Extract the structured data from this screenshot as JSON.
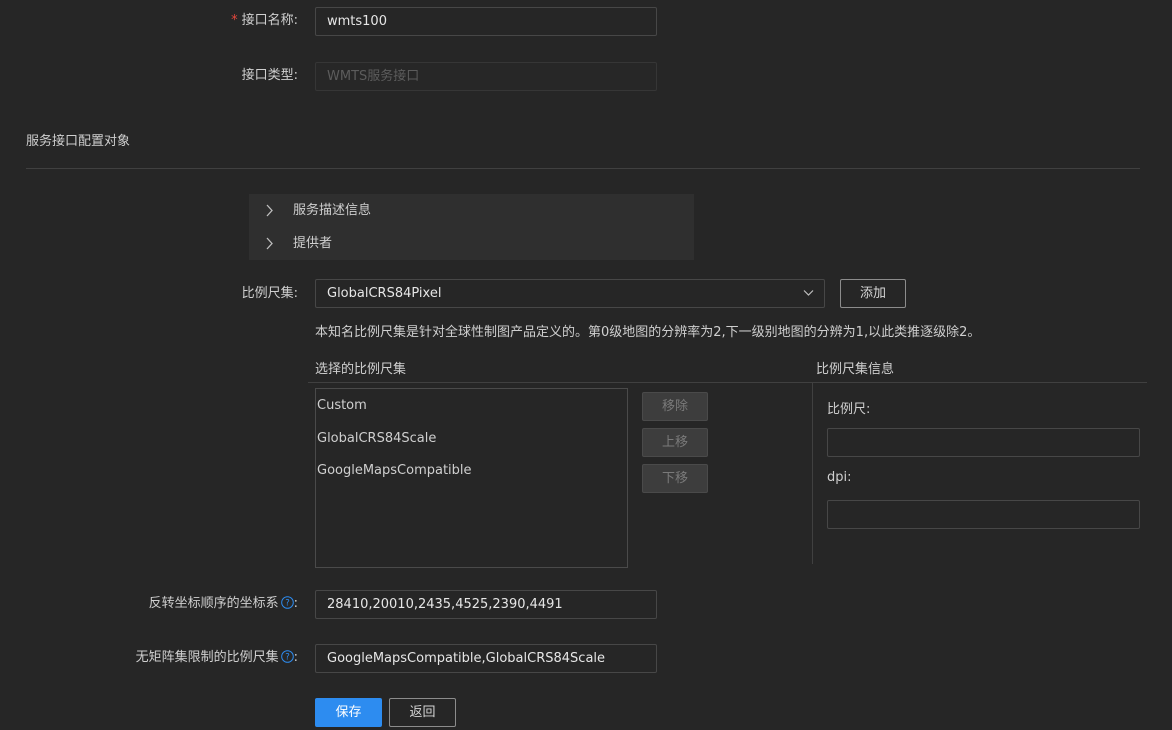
{
  "form": {
    "name_label": "接口名称:",
    "name_value": "wmts100",
    "type_label": "接口类型:",
    "type_placeholder": "WMTS服务接口",
    "section_title": "服务接口配置对象",
    "collapse": [
      "服务描述信息",
      "提供者"
    ],
    "scale_label": "比例尺集:",
    "scale_selected": "GlobalCRS84Pixel",
    "add_button": "添加",
    "scale_hint": "本知名比例尺集是针对全球性制图产品定义的。第0级地图的分辨率为2,下一级别地图的分辨为1,以此类推逐级除2。",
    "selected_title": "选择的比例尺集",
    "info_title": "比例尺集信息",
    "selected_items": [
      "Custom",
      "GlobalCRS84Scale",
      "GoogleMapsCompatible"
    ],
    "remove_button": "移除",
    "up_button": "上移",
    "down_button": "下移",
    "scale_field_label": "比例尺:",
    "dpi_field_label": "dpi:",
    "reverse_label": "反转坐标顺序的坐标系",
    "reverse_value": "28410,20010,2435,4525,2390,4491",
    "unlimited_label": "无矩阵集限制的比例尺集",
    "unlimited_value": "GoogleMapsCompatible,GlobalCRS84Scale",
    "colon": ":",
    "save_button": "保存",
    "back_button": "返回"
  },
  "icons": {
    "chevron": "chevron-right-icon",
    "dropdown": "chevron-down-icon",
    "help": "question-circle-icon"
  },
  "colors": {
    "background": "#262626",
    "primary": "#2d8cf0",
    "required": "#e8483d"
  }
}
